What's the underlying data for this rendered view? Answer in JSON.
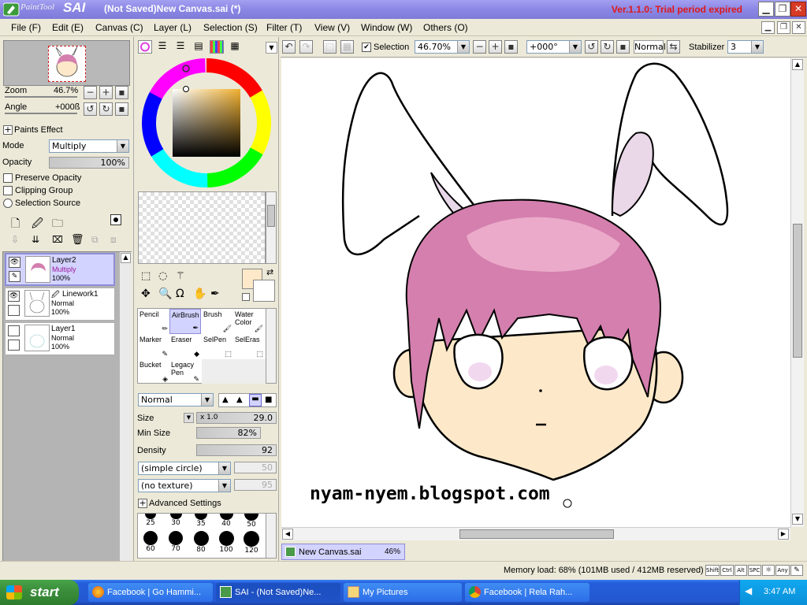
{
  "window": {
    "logo_text": "PaintTool",
    "logo_sai": "SAI",
    "title": "(Not Saved)New Canvas.sai (*)",
    "version": "Ver.1.1.0: Trial period expired"
  },
  "menu": [
    "File (F)",
    "Edit (E)",
    "Canvas (C)",
    "Layer (L)",
    "Selection (S)",
    "Filter (T)",
    "View (V)",
    "Window (W)",
    "Others (O)"
  ],
  "navigator": {
    "zoom_label": "Zoom",
    "zoom_value": "46.7%",
    "angle_label": "Angle",
    "angle_value": "+000ß"
  },
  "layer_props": {
    "paints_effect": "Paints Effect",
    "mode_label": "Mode",
    "mode_value": "Multiply",
    "opacity_label": "Opacity",
    "opacity_value": "100%",
    "preserve_opacity": "Preserve Opacity",
    "clipping_group": "Clipping Group",
    "selection_source": "Selection Source"
  },
  "layers": [
    {
      "name": "Layer2",
      "mode": "Multiply",
      "opacity": "100%"
    },
    {
      "name": "Linework1",
      "mode": "Normal",
      "opacity": "100%"
    },
    {
      "name": "Layer1",
      "mode": "Normal",
      "opacity": "100%"
    }
  ],
  "tools": [
    {
      "name": "Pencil"
    },
    {
      "name": "AirBrush"
    },
    {
      "name": "Brush"
    },
    {
      "name": "Water\nColor"
    },
    {
      "name": "Marker"
    },
    {
      "name": "Eraser"
    },
    {
      "name": "SelPen"
    },
    {
      "name": "SelEras"
    },
    {
      "name": "Bucket"
    },
    {
      "name": "Legacy\nPen"
    }
  ],
  "brush": {
    "blend_mode": "Normal",
    "size_label": "Size",
    "size_mult": "x 1.0",
    "size_value": "29.0",
    "min_size_label": "Min Size",
    "min_size_value": "82%",
    "density_label": "Density",
    "density_value": "92",
    "shape": "(simple circle)",
    "shape_value": "50",
    "texture": "(no texture)",
    "texture_value": "95",
    "advanced": "Advanced Settings",
    "sizes_row1": [
      "25",
      "30",
      "35",
      "40",
      "50"
    ],
    "sizes_row2": [
      "60",
      "70",
      "80",
      "100",
      "120"
    ]
  },
  "canvas_toolbar": {
    "selection_label": "Selection",
    "zoom": "46.70%",
    "rotation": "+000°",
    "blend": "Normal",
    "stabilizer_label": "Stabilizer",
    "stabilizer_value": "3"
  },
  "canvas": {
    "watermark": "nyam-nyem.blogspot.com"
  },
  "doc_tab": {
    "name": "New Canvas.sai",
    "zoom": "46%"
  },
  "status": {
    "memory": "Memory load: 68% (101MB used / 412MB reserved)",
    "keys": [
      "Shift",
      "Ctrl",
      "Alt",
      "SPC",
      "☼",
      "Any",
      "✎"
    ]
  },
  "taskbar": {
    "start": "start",
    "items": [
      "Facebook | Go Hammi...",
      "SAI - (Not Saved)Ne...",
      "My Pictures",
      "Facebook | Rela Rah..."
    ],
    "clock": "3:47 AM"
  },
  "colors": {
    "title_bar": "#8b87e4",
    "version_red": "#e01818",
    "hair_pink": "#d47fae",
    "skin": "#fde9c9",
    "layer_selected": "#d3d3ff",
    "taskbar_blue": "#245edb"
  }
}
